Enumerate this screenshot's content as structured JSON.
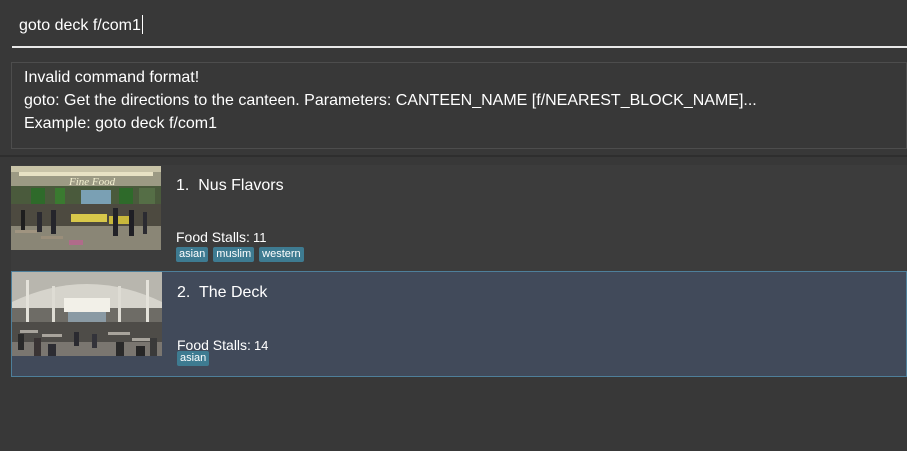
{
  "command_box": {
    "input_value": "goto deck f/com1"
  },
  "result_display": {
    "lines": [
      "Invalid command format!",
      "goto: Get the directions to the canteen. Parameters: CANTEEN_NAME [f/NEAREST_BLOCK_NAME]...",
      "Example: goto deck f/com1"
    ]
  },
  "canteens": [
    {
      "index_label": "1.",
      "name": "Nus Flavors",
      "stalls_label": "Food Stalls:",
      "stalls_count": "11",
      "tags": [
        "asian",
        "muslim",
        "western"
      ],
      "photo_sign": "Fine Food",
      "selected": false
    },
    {
      "index_label": "2.",
      "name": "The Deck",
      "stalls_label": "Food Stalls:",
      "stalls_count": "14",
      "tags": [
        "asian"
      ],
      "selected": true
    }
  ],
  "colors": {
    "background": "#383838",
    "card": "#3c3c3c",
    "card_selected": "#414a5a",
    "selected_border": "#4e7f9a",
    "tag": "#3e7b91",
    "text": "#ffffff"
  }
}
